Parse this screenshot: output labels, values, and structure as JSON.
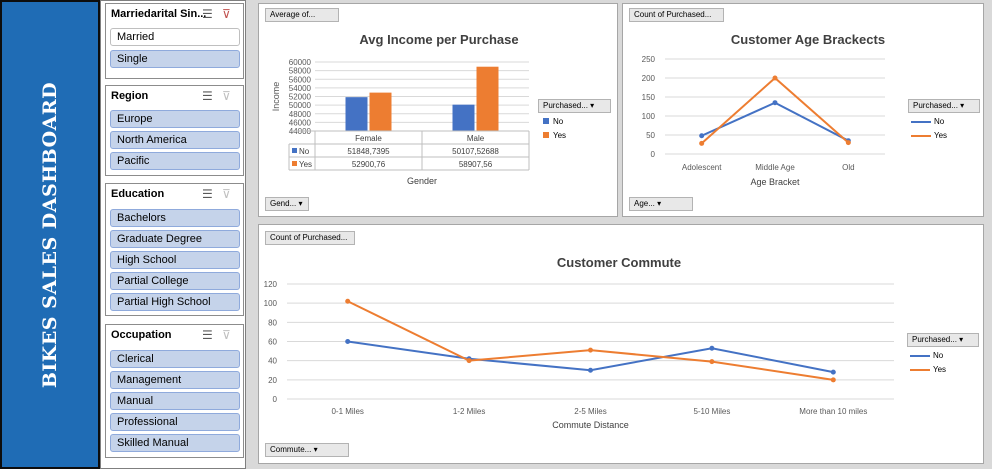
{
  "dashboard_title": "BIKES SALES DASHBOARD",
  "colors": {
    "title_band": "#1f6cb5",
    "series_no": "#4472c4",
    "series_yes": "#ed7d31",
    "slicer_item": "#c5d3ea"
  },
  "slicers": [
    {
      "title": "Marriedarital Sin...",
      "items": [
        {
          "label": "Married",
          "selected": false
        },
        {
          "label": "Single",
          "selected": true
        }
      ]
    },
    {
      "title": "Region",
      "items": [
        {
          "label": "Europe",
          "selected": true
        },
        {
          "label": "North America",
          "selected": true
        },
        {
          "label": "Pacific",
          "selected": true
        }
      ]
    },
    {
      "title": "Education",
      "items": [
        {
          "label": "Bachelors",
          "selected": true
        },
        {
          "label": "Graduate Degree",
          "selected": true
        },
        {
          "label": "High School",
          "selected": true
        },
        {
          "label": "Partial College",
          "selected": true
        },
        {
          "label": "Partial High School",
          "selected": true
        }
      ]
    },
    {
      "title": "Occupation",
      "items": [
        {
          "label": "Clerical",
          "selected": true
        },
        {
          "label": "Management",
          "selected": true
        },
        {
          "label": "Manual",
          "selected": true
        },
        {
          "label": "Professional",
          "selected": true
        },
        {
          "label": "Skilled Manual",
          "selected": true
        }
      ]
    }
  ],
  "income_chart": {
    "value_button": "Average of...",
    "axis_button": "Gend...",
    "legend_button": "Purchased...",
    "legend": [
      "No",
      "Yes"
    ],
    "table": {
      "no_label": "No",
      "yes_label": "Yes",
      "female_header": "Female",
      "male_header": "Male",
      "female_no": "51848,7395",
      "male_no": "50107,52688",
      "female_yes": "52900,76",
      "male_yes": "58907,56"
    }
  },
  "age_chart": {
    "value_button": "Count of Purchased...",
    "axis_button": "Age...",
    "legend_button": "Purchased...",
    "legend": [
      "No",
      "Yes"
    ]
  },
  "commute_chart": {
    "value_button": "Count of Purchased...",
    "axis_button": "Commute...",
    "legend_button": "Purchased...",
    "legend": [
      "No",
      "Yes"
    ]
  },
  "chart_data": [
    {
      "type": "bar",
      "title": "Avg Income per Purchase",
      "xlabel": "Gender",
      "ylabel": "Income",
      "categories": [
        "Female",
        "Male"
      ],
      "series": [
        {
          "name": "No",
          "values": [
            51848.7395,
            50107.52688
          ]
        },
        {
          "name": "Yes",
          "values": [
            52900.76,
            58907.56
          ]
        }
      ],
      "ylim": [
        44000,
        60000
      ],
      "yticks": [
        "60000",
        "58000",
        "56000",
        "54000",
        "52000",
        "50000",
        "48000",
        "46000",
        "44000"
      ],
      "grid": true,
      "legend": "right"
    },
    {
      "type": "line",
      "title": "Customer Age Brackects",
      "xlabel": "Age Bracket",
      "ylabel": "",
      "categories": [
        "Adolescent",
        "Middle Age",
        "Old"
      ],
      "series": [
        {
          "name": "No",
          "values": [
            48,
            135,
            35
          ]
        },
        {
          "name": "Yes",
          "values": [
            28,
            200,
            30
          ]
        }
      ],
      "ylim": [
        0,
        250
      ],
      "yticks": [
        "250",
        "200",
        "150",
        "100",
        "50",
        "0"
      ],
      "grid": true,
      "legend": "right"
    },
    {
      "type": "line",
      "title": "Customer Commute",
      "xlabel": "Commute Distance",
      "ylabel": "",
      "categories": [
        "0-1 Miles",
        "1-2 Miles",
        "2-5 Miles",
        "5-10 Miles",
        "More than 10 miles"
      ],
      "series": [
        {
          "name": "No",
          "values": [
            60,
            42,
            30,
            53,
            28
          ]
        },
        {
          "name": "Yes",
          "values": [
            102,
            40,
            51,
            39,
            20
          ]
        }
      ],
      "ylim": [
        0,
        120
      ],
      "yticks": [
        "120",
        "100",
        "80",
        "60",
        "40",
        "20",
        "0"
      ],
      "grid": true,
      "legend": "right"
    }
  ]
}
